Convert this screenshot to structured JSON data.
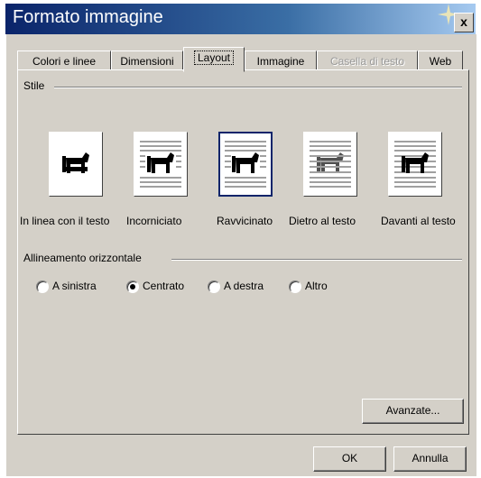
{
  "window": {
    "title": "Formato immagine",
    "close_label": "x"
  },
  "tabs": [
    {
      "label": "Colori e linee",
      "state": "normal"
    },
    {
      "label": "Dimensioni",
      "state": "normal"
    },
    {
      "label": "Layout",
      "state": "active"
    },
    {
      "label": "Immagine",
      "state": "normal"
    },
    {
      "label": "Casella di testo",
      "state": "disabled"
    },
    {
      "label": "Web",
      "state": "normal"
    }
  ],
  "style_group": {
    "title": "Stile",
    "options": [
      {
        "label": "In linea con il testo",
        "icon": "inline-dog-icon",
        "selected": false
      },
      {
        "label": "Incorniciato",
        "icon": "square-dog-icon",
        "selected": false
      },
      {
        "label": "Ravvicinato",
        "icon": "tight-dog-icon",
        "selected": true
      },
      {
        "label": "Dietro al testo",
        "icon": "behind-text-dog-icon",
        "selected": false
      },
      {
        "label": "Davanti al testo",
        "icon": "front-text-dog-icon",
        "selected": false
      }
    ]
  },
  "alignment_group": {
    "title": "Allineamento orizzontale",
    "options": [
      {
        "label": "A sinistra",
        "selected": false
      },
      {
        "label": "Centrato",
        "selected": true
      },
      {
        "label": "A destra",
        "selected": false
      },
      {
        "label": "Altro",
        "selected": false
      }
    ]
  },
  "buttons": {
    "advanced": "Avanzate...",
    "ok": "OK",
    "cancel": "Annulla"
  },
  "colors": {
    "face": "#d4d0c8",
    "title_start": "#0a246a",
    "title_end": "#a6caf0",
    "selection": "#0a246a"
  }
}
